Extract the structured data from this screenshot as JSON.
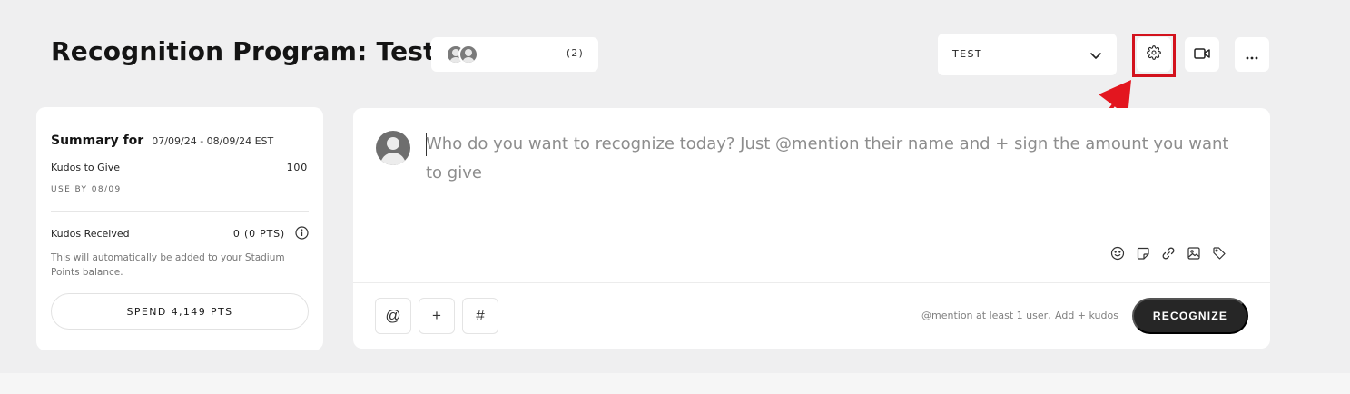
{
  "header": {
    "title": "Recognition Program: Test",
    "members_count": "(2)",
    "program_select_value": "TEST"
  },
  "summary": {
    "heading": "Summary for",
    "date_range": "07/09/24 - 08/09/24 EST",
    "kudos_to_give_label": "Kudos to Give",
    "kudos_to_give_value": "100",
    "use_by": "USE BY 08/09",
    "kudos_received_label": "Kudos Received",
    "kudos_received_value": "0 (0 PTS)",
    "received_note": "This will automatically be added to your Stadium Points balance.",
    "spend_button": "SPEND 4,149 PTS"
  },
  "composer": {
    "placeholder": "Who do you want to recognize today? Just @mention their name and + sign the amount you want to give",
    "mention_symbol": "@",
    "plus_symbol": "+",
    "hash_symbol": "#",
    "hint_mention": "@mention at least 1 user,",
    "hint_kudos": "Add + kudos",
    "recognize_button": "RECOGNIZE"
  },
  "icons": {
    "settings": "gear-icon",
    "video": "video-camera-icon",
    "more": "more-horizontal-icon",
    "emoji": "emoji-icon",
    "sticker": "sticker-icon",
    "link": "link-icon",
    "image": "image-icon",
    "tag": "tag-icon",
    "info": "info-icon",
    "dropdown": "chevron-down-icon"
  },
  "colors": {
    "highlight": "#d3121d",
    "primary_button": "#262626",
    "background": "#efeff0"
  }
}
